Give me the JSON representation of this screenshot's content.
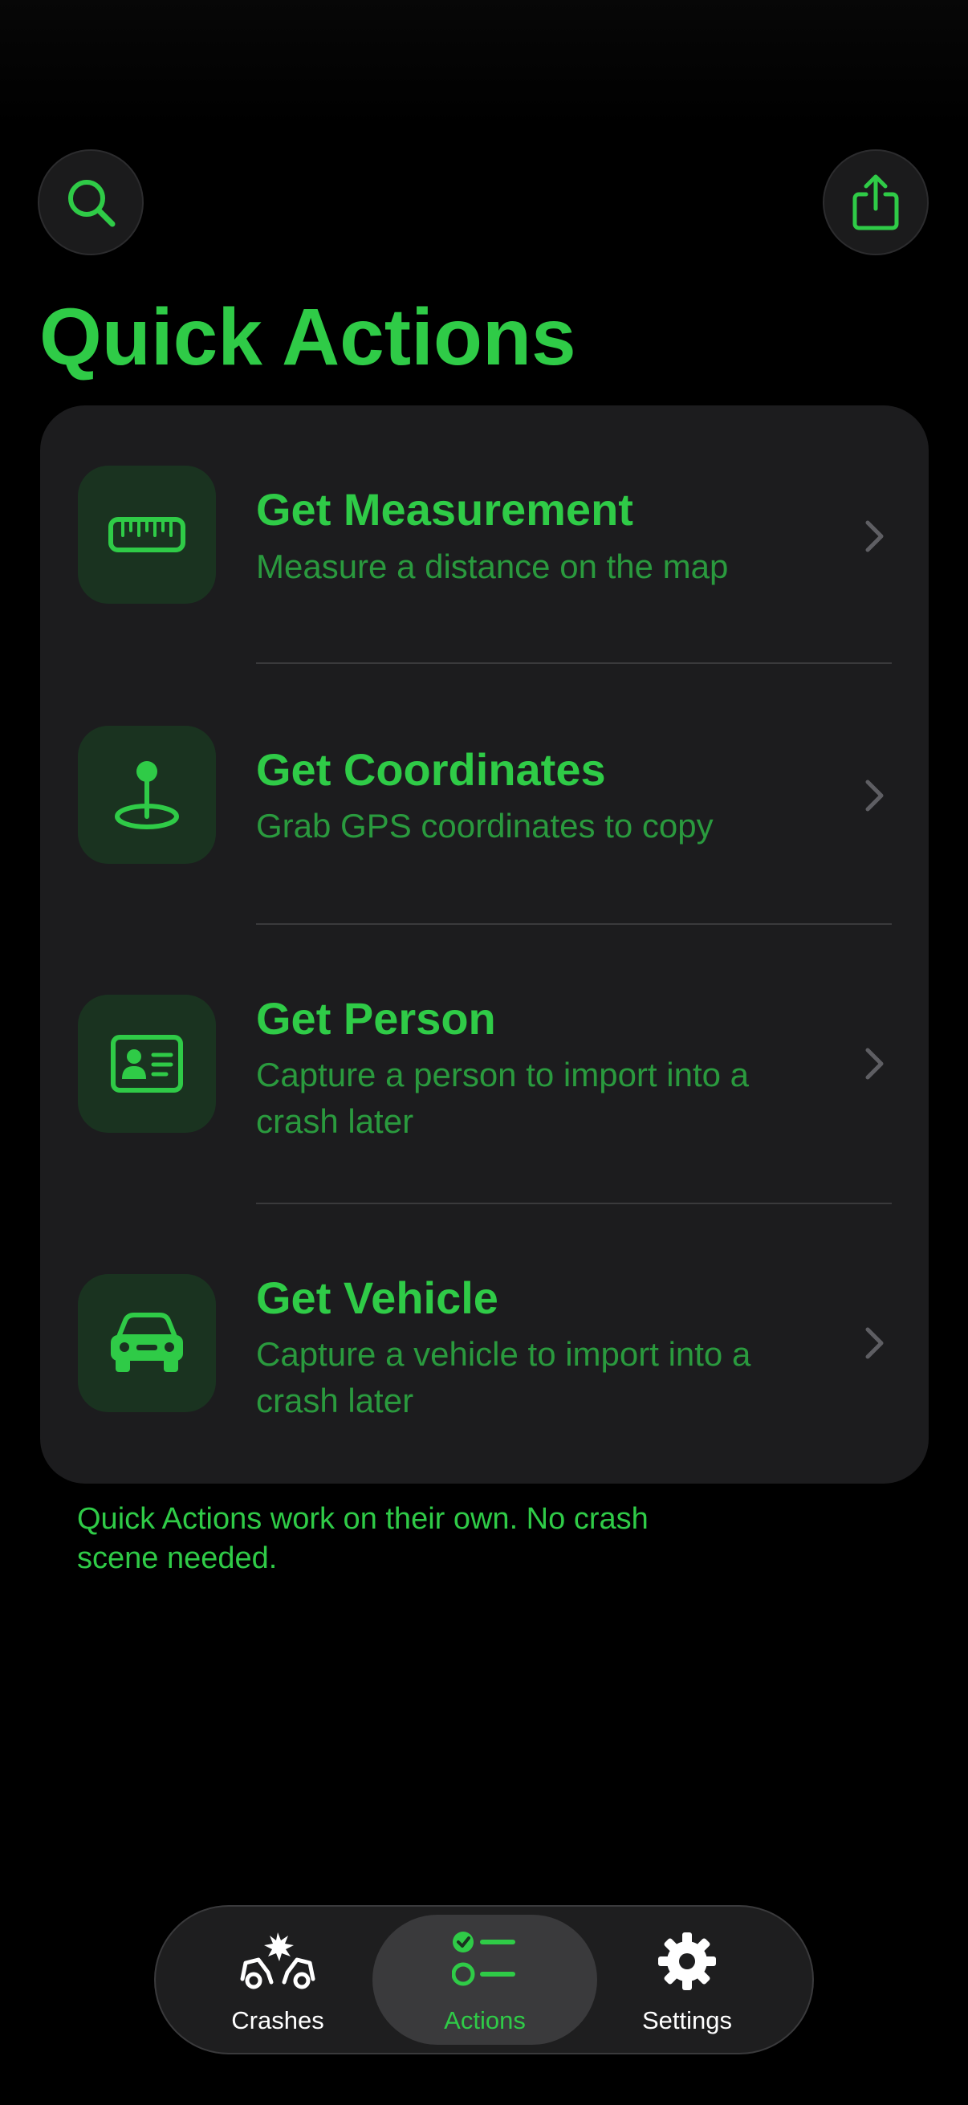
{
  "colors": {
    "accent": "#2FCB47",
    "accent_dim": "#2A9A3E",
    "background": "#000000",
    "card": "#1C1C1E",
    "icon_tile": "#1A3320"
  },
  "header": {
    "search_icon": "search-icon",
    "share_icon": "share-icon"
  },
  "page": {
    "title": "Quick Actions",
    "footnote": "Quick Actions work on their own. No crash scene needed."
  },
  "actions": [
    {
      "icon": "ruler-icon",
      "title": "Get Measurement",
      "subtitle": "Measure a distance on the map"
    },
    {
      "icon": "location-pin-icon",
      "title": "Get Coordinates",
      "subtitle": "Grab GPS coordinates to copy"
    },
    {
      "icon": "person-card-icon",
      "title": "Get Person",
      "subtitle": "Capture a person to import into a crash later"
    },
    {
      "icon": "car-icon",
      "title": "Get Vehicle",
      "subtitle": "Capture a vehicle to import into a crash later"
    }
  ],
  "tabbar": {
    "tabs": [
      {
        "label": "Crashes",
        "icon": "car-crash-icon",
        "active": false
      },
      {
        "label": "Actions",
        "icon": "checklist-icon",
        "active": true
      },
      {
        "label": "Settings",
        "icon": "gear-icon",
        "active": false
      }
    ]
  }
}
